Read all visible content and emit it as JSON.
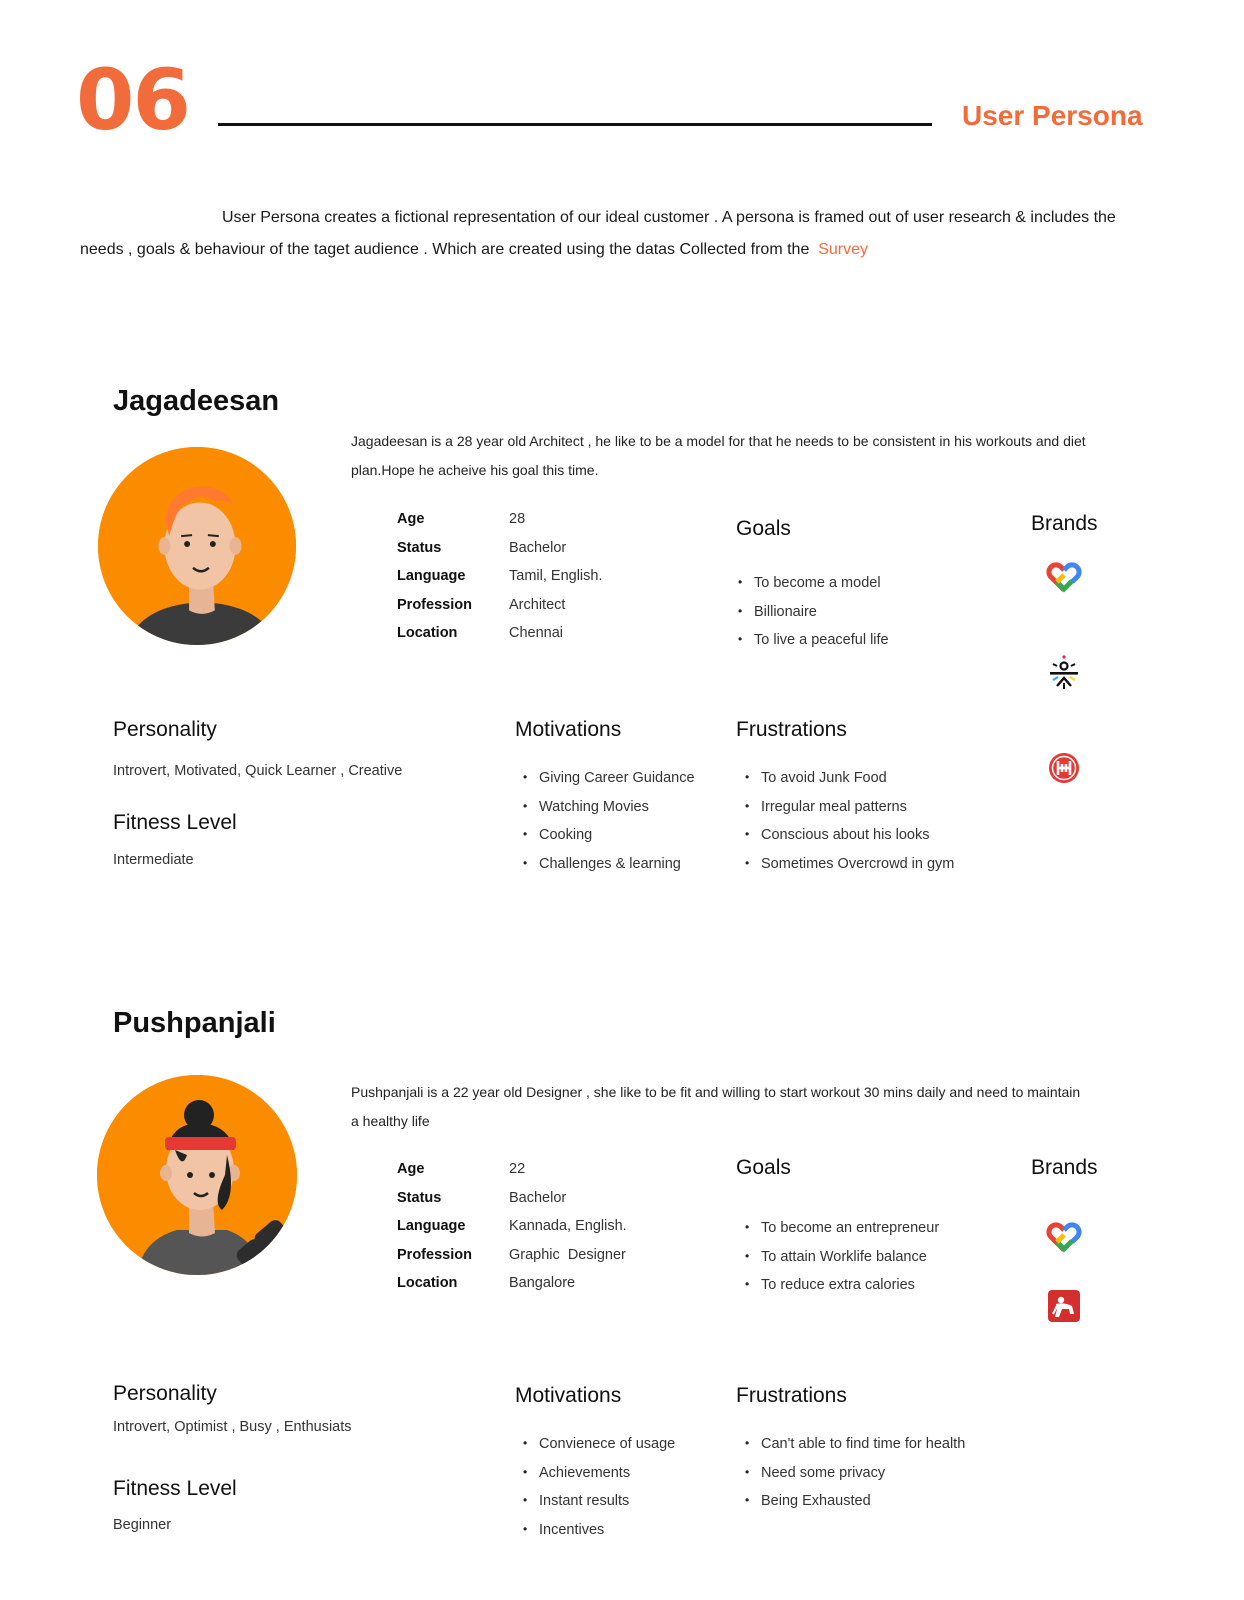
{
  "header": {
    "page_number": "06",
    "section_title": "User Persona"
  },
  "intro": {
    "text": "User Persona creates a fictional representation of our ideal customer . A persona is framed out of user research & includes the needs , goals & behaviour of the taget audience . Which are created using the datas Collected from the",
    "link_text": "Survey"
  },
  "colors": {
    "accent": "#f26b3a",
    "avatar_bg": "#fb8c00"
  },
  "labels": {
    "goals": "Goals",
    "brands": "Brands",
    "personality": "Personality",
    "motivations": "Motivations",
    "frustrations": "Frustrations",
    "fitness_level": "Fitness Level"
  },
  "personas": [
    {
      "name": "Jagadeesan",
      "bio": "Jagadeesan  is a 28 year old Architect , he like to be a model for that he needs to be consistent in his workouts and diet plan.Hope he acheive his goal this time.",
      "facts": [
        {
          "label": "Age",
          "value": "28"
        },
        {
          "label": "Status",
          "value": "Bachelor"
        },
        {
          "label": "Language",
          "value": "Tamil, English."
        },
        {
          "label": "Profession",
          "value": "Architect"
        },
        {
          "label": "Location",
          "value": "Chennai"
        }
      ],
      "goals": [
        "To become a model",
        "Billionaire",
        "To live a peaceful life"
      ],
      "brands": [
        "google-fit-icon",
        "cult-fit-icon",
        "healthify-icon"
      ],
      "personality": "Introvert, Motivated, Quick Learner , Creative",
      "fitness_level": "Intermediate",
      "motivations": [
        "Giving Career Guidance",
        "Watching Movies",
        "Cooking",
        "Challenges & learning"
      ],
      "frustrations": [
        "To avoid Junk Food",
        "Irregular meal patterns",
        "Conscious about his looks",
        "Sometimes Overcrowd in gym"
      ]
    },
    {
      "name": "Pushpanjali",
      "bio": "Pushpanjali is a 22 year old Designer , she like to be fit and willing to start  workout 30 mins daily  and need to maintain  a healthy life",
      "facts": [
        {
          "label": "Age",
          "value": "22"
        },
        {
          "label": "Status",
          "value": "Bachelor"
        },
        {
          "label": "Language",
          "value": "Kannada, English."
        },
        {
          "label": "Profession",
          "value": "Graphic  Designer"
        },
        {
          "label": "Location",
          "value": "Bangalore"
        }
      ],
      "goals": [
        "To become an entrepreneur",
        "To attain Worklife balance",
        "To reduce extra calories"
      ],
      "brands": [
        "google-fit-icon",
        "home-workout-icon"
      ],
      "personality": "Introvert, Optimist , Busy , Enthusiats",
      "fitness_level": "Beginner",
      "motivations": [
        "Convienece of usage",
        "Achievements",
        "Instant results",
        "Incentives"
      ],
      "frustrations": [
        "Can't able to find time for health",
        "Need some privacy",
        "Being Exhausted"
      ]
    }
  ]
}
